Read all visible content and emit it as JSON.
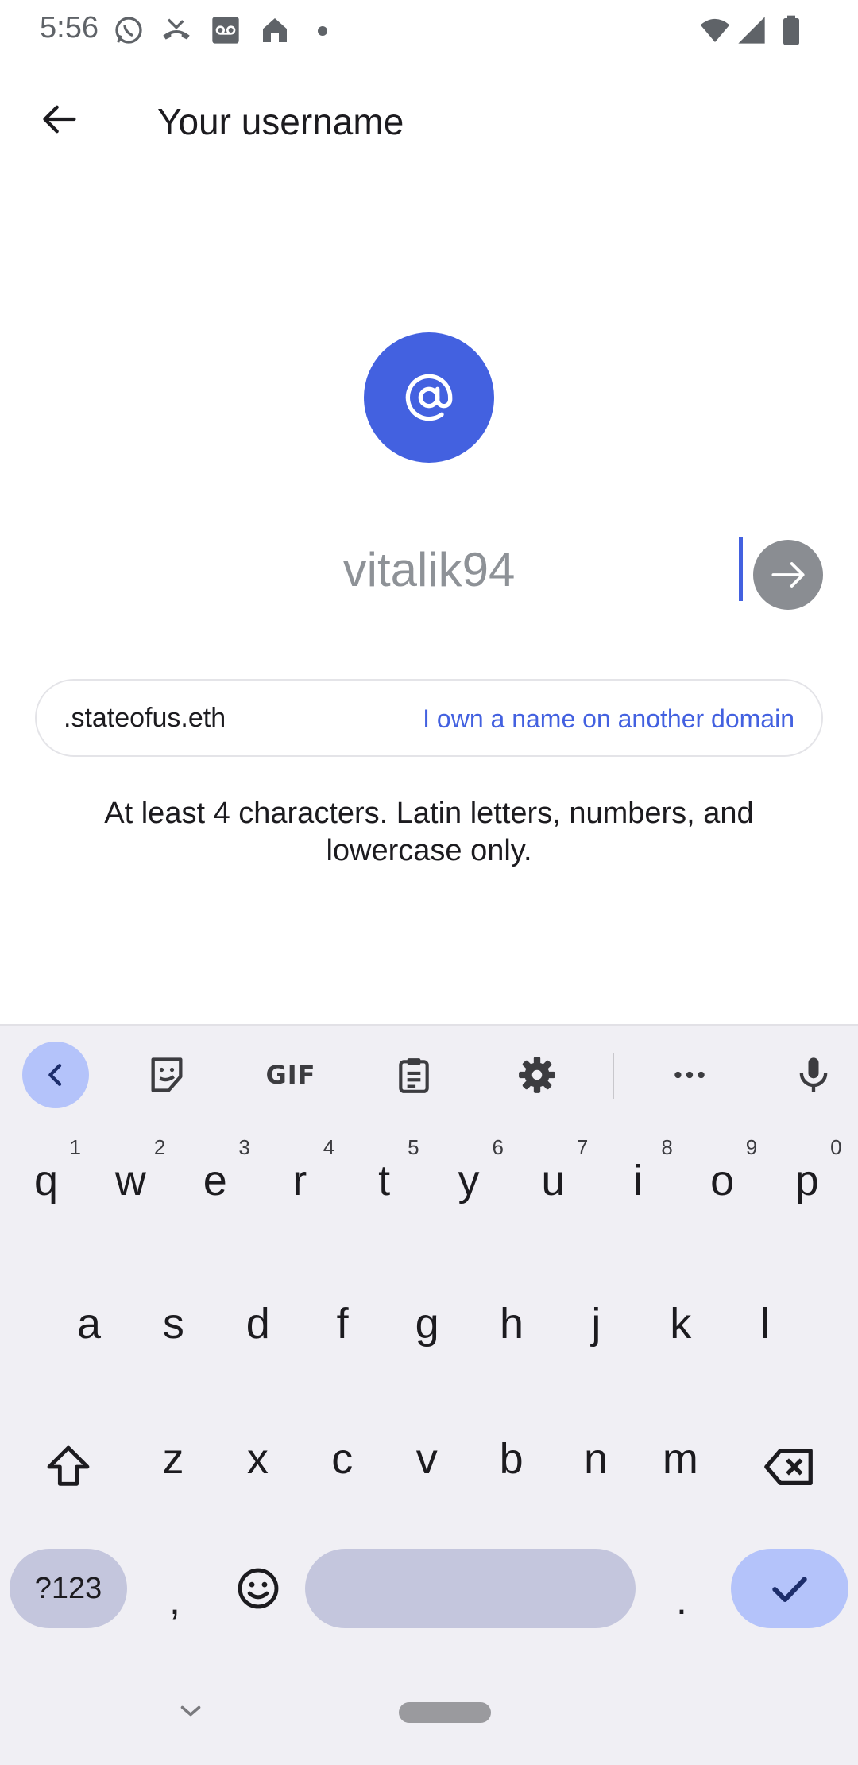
{
  "status_bar": {
    "time": "5:56"
  },
  "app_bar": {
    "title": "Your username"
  },
  "username": {
    "placeholder": "vitalik94",
    "value": ""
  },
  "domain": {
    "suffix": ".stateofus.eth",
    "other_link": "I own a name on another domain"
  },
  "hint": "At least 4 characters. Latin letters, numbers, and lowercase only.",
  "keyboard": {
    "toolbar": {
      "gif_label": "GIF"
    },
    "row1": [
      {
        "k": "q",
        "n": "1"
      },
      {
        "k": "w",
        "n": "2"
      },
      {
        "k": "e",
        "n": "3"
      },
      {
        "k": "r",
        "n": "4"
      },
      {
        "k": "t",
        "n": "5"
      },
      {
        "k": "y",
        "n": "6"
      },
      {
        "k": "u",
        "n": "7"
      },
      {
        "k": "i",
        "n": "8"
      },
      {
        "k": "o",
        "n": "9"
      },
      {
        "k": "p",
        "n": "0"
      }
    ],
    "row2": [
      "a",
      "s",
      "d",
      "f",
      "g",
      "h",
      "j",
      "k",
      "l"
    ],
    "row3": [
      "z",
      "x",
      "c",
      "v",
      "b",
      "n",
      "m"
    ],
    "symbols_label": "?123",
    "comma": ",",
    "period": "."
  },
  "colors": {
    "accent": "#4361e0",
    "keyboard_bg": "#f0eff4",
    "enter_key": "#b4c3fa"
  }
}
